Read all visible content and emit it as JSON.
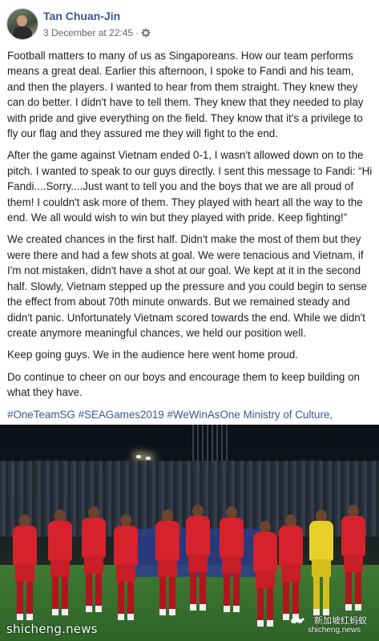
{
  "post": {
    "author": "Tan Chuan-Jin",
    "date": "3 December at 22:45",
    "separator": "·",
    "privacy_icon": "gear-icon",
    "paragraphs": [
      "Football matters to many of us as Singaporeans. How our team performs means a great deal. Earlier this afternoon, I spoke to Fandi and his team, and then the players. I wanted to hear from them straight. They knew they can do better. I didn't have to tell them. They knew that they needed to play with pride and give everything on the field. They know that it's a privilege to fly our flag and they assured me they will fight to the end.",
      "After the game against Vietnam ended 0-1, I wasn't allowed down on to the pitch. I wanted to speak to our guys directly. I sent this message to Fandi: “Hi Fandi....Sorry....Just want to tell you and the boys that we are all proud of them! I couldn't ask more of them. They played with heart all the way to the end. We all would wish to win but they played with pride. Keep fighting!”",
      "We created chances in the first half. Didn't make the most of them but they were there and had a few shots at goal. We were tenacious and Vietnam, if I'm not mistaken, didn't have a shot at our goal. We kept at it in the second half. Slowly, Vietnam stepped up the pressure and you could begin to sense the effect from about 70th minute onwards. But we remained steady and didn't panic. Unfortunately Vietnam scored towards the end. While we didn't create anymore meaningful chances, we held our position well.",
      "Keep going guys. We in the audience here went home proud.",
      "Do continue to cheer on our boys and encourage them to keep building on what they have."
    ],
    "tags": "#OneTeamSG #SEAGames2019 #WeWinAsOne Ministry of Culture, Community and Youth - MCCYSingapore National Olympic CouncilTeam SingaporeFootball Association of Singapore"
  },
  "photo": {
    "description_icon": "team-photo"
  },
  "watermarks": {
    "left": "shicheng.news",
    "right_cn": "新加坡红蚂蚁",
    "right_en": "shicheng.news"
  },
  "colors": {
    "link": "#385898",
    "text": "#1c1e21",
    "meta": "#606770"
  }
}
